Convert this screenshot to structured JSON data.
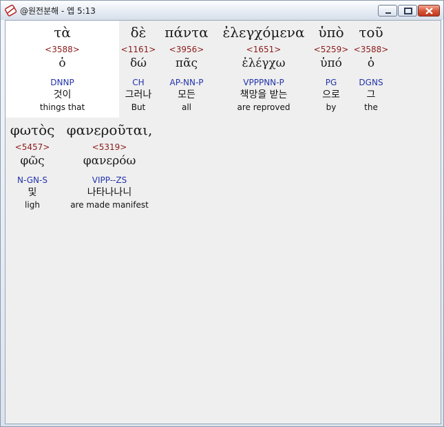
{
  "window": {
    "title": "@원전분해 - 엡 5:13",
    "icon": "app-icon",
    "controls": [
      "minimize-button",
      "maximize-button",
      "close-button"
    ]
  },
  "colors": {
    "strong_number": "#8b1a1a",
    "parsing": "#2233aa",
    "selected_background": "#ffffff",
    "content_background": "#efefef"
  },
  "rows": [
    {
      "words": [
        {
          "greek": "τὰ",
          "strong": "<3588>",
          "lemma": "ὁ",
          "parsing": "DNNP",
          "korean": "것이",
          "english": "things that",
          "selected": true
        },
        {
          "greek": "δὲ",
          "strong": "<1161>",
          "lemma": "δώ",
          "parsing": "CH",
          "korean": "그러나",
          "english": "But"
        },
        {
          "greek": "πάντα",
          "strong": "<3956>",
          "lemma": "πᾶς",
          "parsing": "AP-NN-P",
          "korean": "모든",
          "english": "all"
        },
        {
          "greek": "ἐλεγχόμενα",
          "strong": "<1651>",
          "lemma": "ἐλέγχω",
          "parsing": "VPPPNN-P",
          "korean": "책망을 받는",
          "english": "are reproved"
        },
        {
          "greek": "ὑπὸ",
          "strong": "<5259>",
          "lemma": "ὑπό",
          "parsing": "PG",
          "korean": "으로",
          "english": "by"
        },
        {
          "greek": "τοῦ",
          "strong": "<3588>",
          "lemma": "ὁ",
          "parsing": "DGNS",
          "korean": "그",
          "english": "the"
        }
      ]
    },
    {
      "words": [
        {
          "greek": "φωτὸς",
          "strong": "<5457>",
          "lemma": "φῶς",
          "parsing": "N-GN-S",
          "korean": "및",
          "english": "ligh"
        },
        {
          "greek": "φανεροῦται,",
          "strong": "<5319>",
          "lemma": "φανερόω",
          "parsing": "VIPP--ZS",
          "korean": "나타나나니",
          "english": "are made manifest"
        }
      ]
    }
  ]
}
